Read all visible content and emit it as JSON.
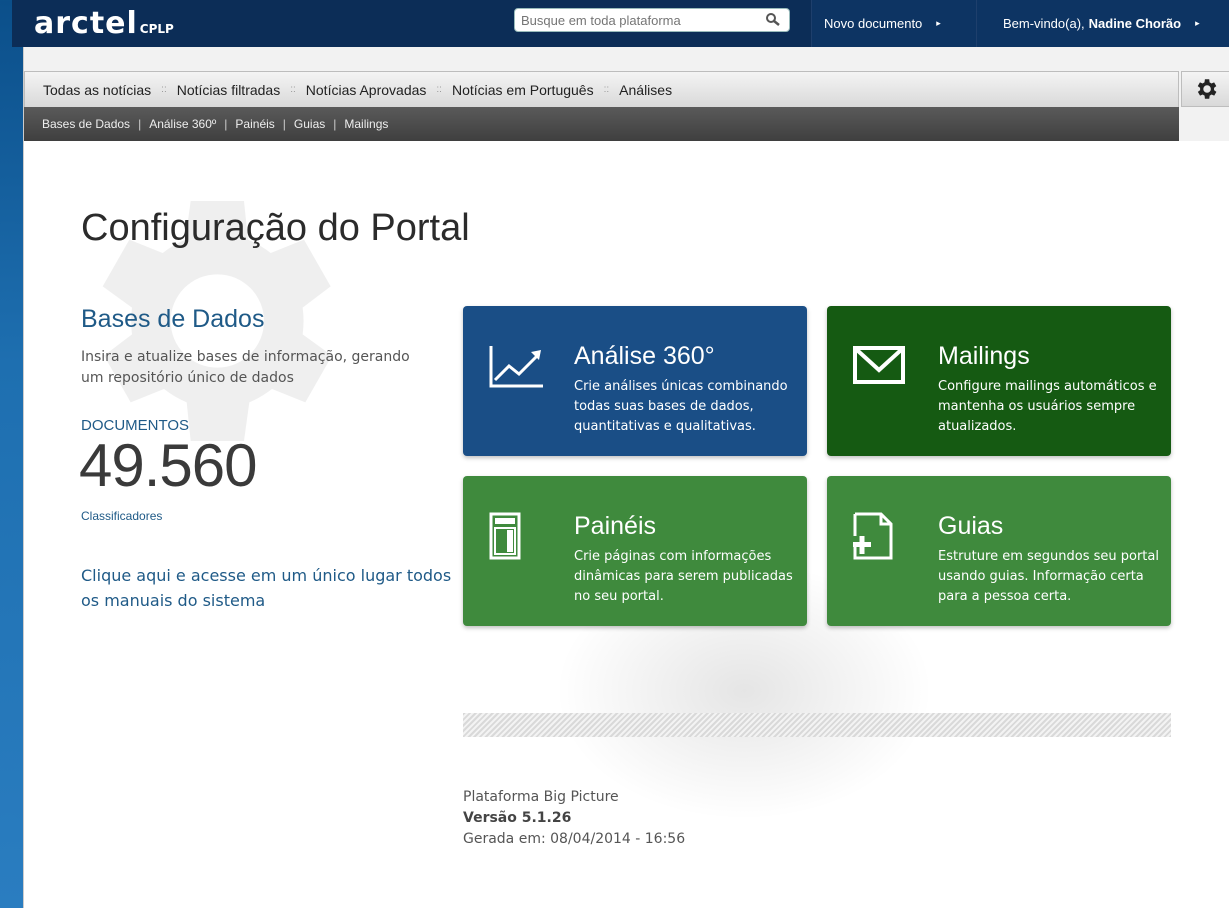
{
  "header": {
    "logo_main": "arctel",
    "logo_sub": "CPLP",
    "search_placeholder": "Busque em toda plataforma",
    "new_doc_label": "Novo documento",
    "welcome_label": "Bem-vindo(a),",
    "user_name": "Nadine Chorão"
  },
  "nav": {
    "primary": [
      {
        "label": "Todas as notícias"
      },
      {
        "label": "Notícias filtradas"
      },
      {
        "label": "Notícias Aprovadas"
      },
      {
        "label": "Notícias em Português"
      },
      {
        "label": "Análises"
      }
    ],
    "primary_separator": "::",
    "secondary": [
      {
        "label": "Bases de Dados"
      },
      {
        "label": "Análise 360º"
      },
      {
        "label": "Painéis"
      },
      {
        "label": "Guias"
      },
      {
        "label": "Mailings"
      }
    ],
    "secondary_separator": "|"
  },
  "main": {
    "page_title": "Configuração do Portal",
    "databases": {
      "title": "Bases de Dados",
      "description": "Insira e atualize bases de informação, gerando um repositório único de dados",
      "documents_label": "DOCUMENTOS",
      "documents_count": "49.560",
      "classifiers_link": "Classificadores",
      "manuals_link": "Clique aqui e acesse em um único lugar todos os manuais do sistema"
    },
    "tiles": [
      {
        "title": "Análise 360°",
        "description": "Crie análises únicas combinando todas suas bases de dados, quantitativas e qualitativas.",
        "icon": "chart-trend-icon",
        "color": "#1a4e86"
      },
      {
        "title": "Mailings",
        "description": "Configure mailings automáticos e mantenha os usuários sempre atualizados.",
        "icon": "envelope-icon",
        "color": "#155a12"
      },
      {
        "title": "Painéis",
        "description": "Crie páginas com informações dinâmicas para serem publicadas no seu portal.",
        "icon": "panel-layout-icon",
        "color": "#3f8a3d"
      },
      {
        "title": "Guias",
        "description": "Estruture em segundos seu portal usando guias. Informação certa para a pessoa certa.",
        "icon": "add-page-icon",
        "color": "#3f8a3d"
      }
    ]
  },
  "footer": {
    "platform": "Plataforma Big Picture",
    "version": "Versão 5.1.26",
    "generated": "Gerada em: 08/04/2014 - 16:56"
  }
}
